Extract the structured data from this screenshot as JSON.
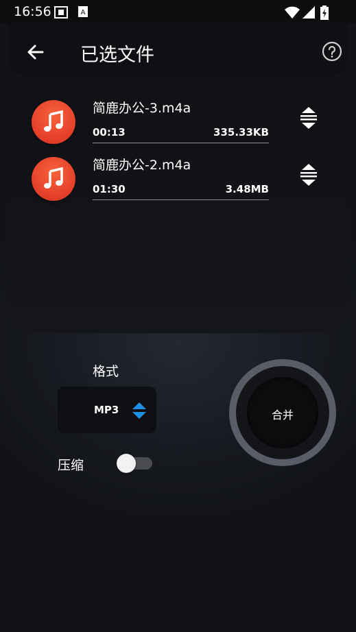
{
  "status_bar": {
    "time": "16:56",
    "icons": [
      "screenshot-icon",
      "keyboard-icon",
      "wifi-icon",
      "signal-icon",
      "battery-icon"
    ]
  },
  "header": {
    "back_icon": "arrow-left-icon",
    "title": "已选文件",
    "help_icon": "question-circle-icon"
  },
  "files": [
    {
      "name": "简鹿办公-3.m4a",
      "duration": "00:13",
      "size": "335.33KB",
      "icon": "music-note-icon"
    },
    {
      "name": "简鹿办公-2.m4a",
      "duration": "01:30",
      "size": "3.48MB",
      "icon": "music-note-icon"
    }
  ],
  "format": {
    "label": "格式",
    "value": "MP3",
    "arrow_color": "#1e8fe6"
  },
  "compress": {
    "label": "压缩",
    "enabled": false
  },
  "merge_button": {
    "label": "合并"
  },
  "colors": {
    "accent_orange": "#e8432d",
    "background": "#171a20"
  }
}
